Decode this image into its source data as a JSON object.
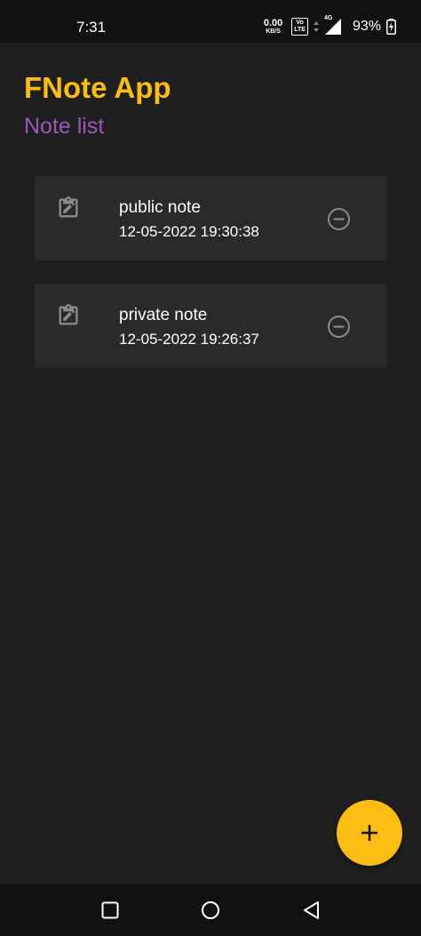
{
  "status_bar": {
    "time": "7:31",
    "net_speed_value": "0.00",
    "net_speed_unit": "KB/S",
    "volte_top": "Vo",
    "volte_bottom": "LTE",
    "network": "4G",
    "battery": "93%"
  },
  "header": {
    "title": "FNote App",
    "subtitle": "Note list"
  },
  "notes": [
    {
      "title": "public note",
      "date": "12-05-2022 19:30:38"
    },
    {
      "title": "private note",
      "date": "12-05-2022 19:26:37"
    }
  ],
  "icons": {
    "note": "clipboard-edit-icon",
    "remove": "minus-circle-icon",
    "add": "plus-icon"
  },
  "colors": {
    "background": "#1f1f1f",
    "card": "#2a2a2a",
    "title": "#fbbd14",
    "subtitle": "#9b59b6",
    "fab": "#fbbd14"
  }
}
